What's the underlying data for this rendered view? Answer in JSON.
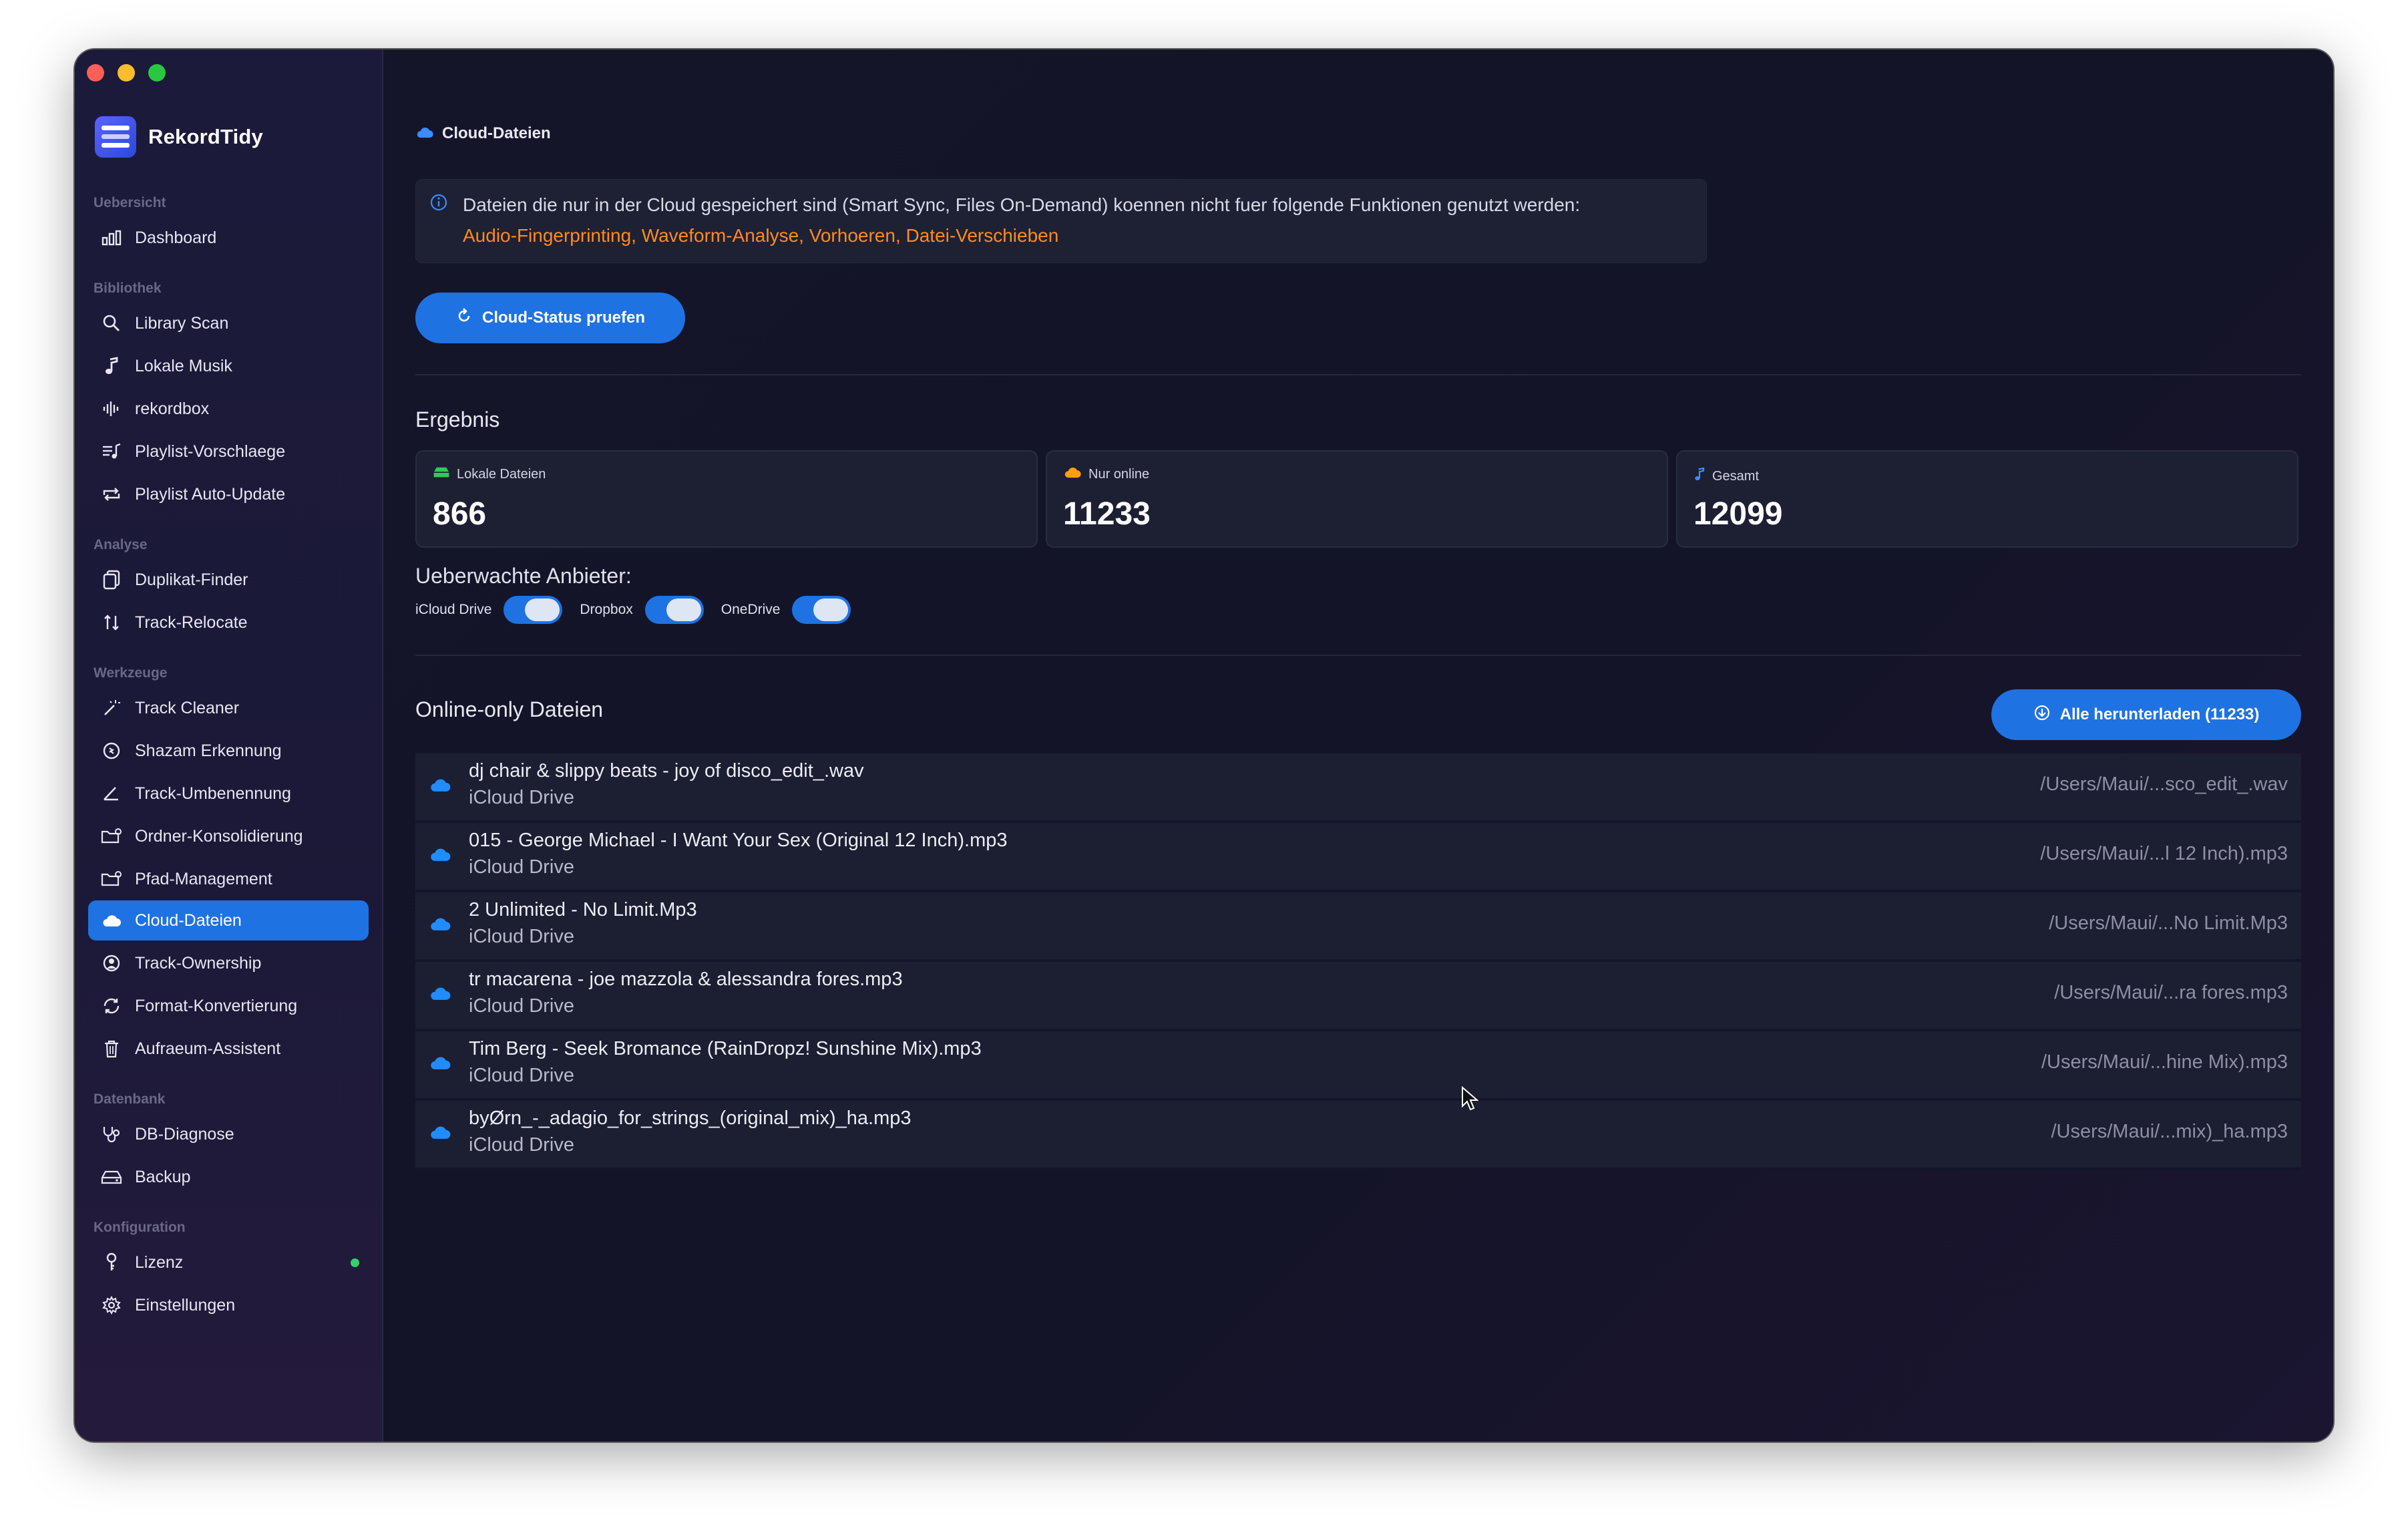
{
  "app": {
    "name": "RekordTidy"
  },
  "sidebar": {
    "sections": [
      {
        "title": "Uebersicht",
        "items": [
          {
            "label": "Dashboard",
            "icon": "bar-chart-icon"
          }
        ]
      },
      {
        "title": "Bibliothek",
        "items": [
          {
            "label": "Library Scan",
            "icon": "magnifier-icon"
          },
          {
            "label": "Lokale Musik",
            "icon": "music-note-icon"
          },
          {
            "label": "rekordbox",
            "icon": "waveform-icon"
          },
          {
            "label": "Playlist-Vorschlaege",
            "icon": "playlist-icon"
          },
          {
            "label": "Playlist Auto-Update",
            "icon": "repeat-icon"
          }
        ]
      },
      {
        "title": "Analyse",
        "items": [
          {
            "label": "Duplikat-Finder",
            "icon": "duplicate-icon"
          },
          {
            "label": "Track-Relocate",
            "icon": "relocate-icon"
          }
        ]
      },
      {
        "title": "Werkzeuge",
        "items": [
          {
            "label": "Track Cleaner",
            "icon": "magic-wand-icon"
          },
          {
            "label": "Shazam Erkennung",
            "icon": "shazam-icon"
          },
          {
            "label": "Track-Umbenennung",
            "icon": "pencil-angle-icon"
          },
          {
            "label": "Ordner-Konsolidierung",
            "icon": "folder-gear-icon"
          },
          {
            "label": "Pfad-Management",
            "icon": "folder-gear-icon"
          },
          {
            "label": "Cloud-Dateien",
            "icon": "cloud-icon",
            "active": true
          },
          {
            "label": "Track-Ownership",
            "icon": "person-circle-icon"
          },
          {
            "label": "Format-Konvertierung",
            "icon": "convert-arrows-icon"
          },
          {
            "label": "Aufraeum-Assistent",
            "icon": "trash-icon"
          }
        ]
      },
      {
        "title": "Datenbank",
        "items": [
          {
            "label": "DB-Diagnose",
            "icon": "stethoscope-icon"
          },
          {
            "label": "Backup",
            "icon": "drive-icon"
          }
        ]
      },
      {
        "title": "Konfiguration",
        "items": [
          {
            "label": "Lizenz",
            "icon": "key-icon",
            "status_dot": "#2fd36a"
          },
          {
            "label": "Einstellungen",
            "icon": "gear-icon"
          }
        ]
      }
    ]
  },
  "main": {
    "breadcrumb": "Cloud-Dateien",
    "info": {
      "text": "Dateien die nur in der Cloud gespeichert sind (Smart Sync, Files On-Demand) koennen nicht fuer folgende Funktionen genutzt werden:",
      "features": "Audio-Fingerprinting, Waveform-Analyse, Vorhoeren, Datei-Verschieben"
    },
    "check_button": "Cloud-Status pruefen",
    "result_title": "Ergebnis",
    "stats": [
      {
        "label": "Lokale Dateien",
        "value": "866",
        "icon": "drive-icon",
        "color": "#34c759"
      },
      {
        "label": "Nur online",
        "value": "11233",
        "icon": "cloud-icon",
        "color": "#ff9f0a"
      },
      {
        "label": "Gesamt",
        "value": "12099",
        "icon": "music-note-icon",
        "color": "#3b8cff"
      }
    ],
    "providers_title": "Ueberwachte Anbieter:",
    "providers": [
      {
        "label": "iCloud Drive",
        "enabled": true
      },
      {
        "label": "Dropbox",
        "enabled": true
      },
      {
        "label": "OneDrive",
        "enabled": true
      }
    ],
    "online_title": "Online-only Dateien",
    "download_all_button": "Alle herunterladen (11233)",
    "files": [
      {
        "name": "dj chair & slippy beats - joy of disco_edit_.wav",
        "provider": "iCloud Drive",
        "path": "/Users/Maui/...sco_edit_.wav"
      },
      {
        "name": "015 - George Michael - I Want Your Sex (Original 12 Inch).mp3",
        "provider": "iCloud Drive",
        "path": "/Users/Maui/...l 12 Inch).mp3"
      },
      {
        "name": "2 Unlimited - No Limit.Mp3",
        "provider": "iCloud Drive",
        "path": "/Users/Maui/...No Limit.Mp3"
      },
      {
        "name": "tr macarena - joe mazzola & alessandra fores.mp3",
        "provider": "iCloud Drive",
        "path": "/Users/Maui/...ra fores.mp3"
      },
      {
        "name": "Tim Berg - Seek Bromance (RainDropz! Sunshine Mix).mp3",
        "provider": "iCloud Drive",
        "path": "/Users/Maui/...hine Mix).mp3"
      },
      {
        "name": "byØrn_-_adagio_for_strings_(original_mix)_ha.mp3",
        "provider": "iCloud Drive",
        "path": "/Users/Maui/...mix)_ha.mp3"
      }
    ]
  },
  "colors": {
    "accent": "#1f72e2",
    "warning": "#ff8c1a",
    "cloud": "#1f8cff"
  }
}
